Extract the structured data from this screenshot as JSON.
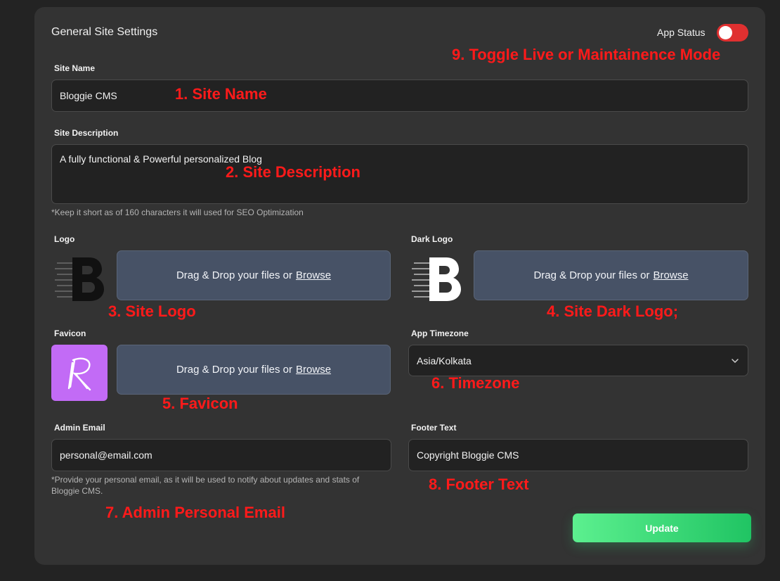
{
  "header": {
    "title": "General Site Settings",
    "app_status_label": "App Status",
    "app_status_on": true
  },
  "site_name": {
    "label": "Site Name",
    "value": "Bloggie CMS"
  },
  "site_description": {
    "label": "Site Description",
    "value": "A fully functional & Powerful personalized Blog",
    "hint": "*Keep it short as of 160 characters it will used for SEO Optimization"
  },
  "logo": {
    "label": "Logo",
    "drop_text": "Drag & Drop your files or",
    "browse": "Browse"
  },
  "dark_logo": {
    "label": "Dark Logo",
    "drop_text": "Drag & Drop your files or",
    "browse": "Browse"
  },
  "favicon": {
    "label": "Favicon",
    "drop_text": "Drag & Drop your files or",
    "browse": "Browse"
  },
  "timezone": {
    "label": "App Timezone",
    "value": "Asia/Kolkata"
  },
  "admin_email": {
    "label": "Admin Email",
    "value": "personal@email.com",
    "hint_line1": "*Provide your personal email, as it will be used to notify about updates and stats of",
    "hint_line2": "Bloggie CMS."
  },
  "footer_text": {
    "label": "Footer Text",
    "value": "Copyright Bloggie CMS"
  },
  "update_button": "Update",
  "annotations": {
    "a1": "1. Site Name",
    "a2": "2. Site Description",
    "a3": "3. Site Logo",
    "a4": "4. Site Dark Logo;",
    "a5": "5. Favicon",
    "a6": "6. Timezone",
    "a7": "7. Admin Personal Email",
    "a8": "8. Footer Text",
    "a9": "9. Toggle Live or Maintainence Mode"
  },
  "colors": {
    "panel": "#333333",
    "background": "#232323",
    "toggle": "#e03030",
    "drop_zone": "#475266",
    "favicon_bg": "#c26bf6",
    "update_start": "#5cf08f",
    "update_end": "#20c463",
    "annotation": "#ff1a1a"
  },
  "icons": {
    "logo": "bloggie-b-logo-icon",
    "dark_logo": "bloggie-b-logo-white-icon",
    "favicon": "bloggie-r-favicon-icon",
    "select": "chevron-down-icon"
  }
}
